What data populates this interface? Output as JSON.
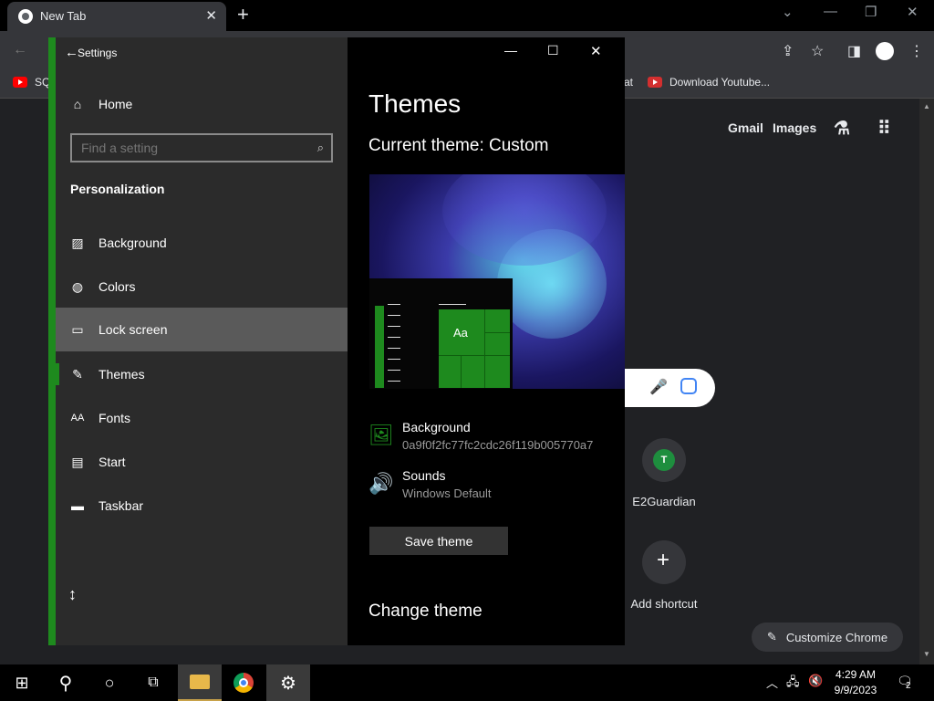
{
  "browser": {
    "tab_title": "New Tab",
    "bookmarks": [
      {
        "label": "SQ"
      },
      {
        "label": "at"
      },
      {
        "label": "Download Youtube..."
      }
    ],
    "links": {
      "gmail": "Gmail",
      "images": "Images"
    },
    "shortcuts": [
      {
        "label": "E2Guardian",
        "badge": "T"
      },
      {
        "label": "Add shortcut"
      }
    ],
    "customize_label": "Customize Chrome"
  },
  "settings": {
    "window_title": "Settings",
    "nav": {
      "home": "Home",
      "search_placeholder": "Find a setting",
      "section": "Personalization",
      "items": [
        {
          "label": "Background",
          "icon": "image-icon"
        },
        {
          "label": "Colors",
          "icon": "palette-icon"
        },
        {
          "label": "Lock screen",
          "icon": "lock-screen-icon"
        },
        {
          "label": "Themes",
          "icon": "themes-icon"
        },
        {
          "label": "Fonts",
          "icon": "fonts-icon"
        },
        {
          "label": "Start",
          "icon": "start-icon"
        },
        {
          "label": "Taskbar",
          "icon": "taskbar-icon"
        }
      ]
    },
    "main": {
      "title": "Themes",
      "current_theme": "Current theme: Custom",
      "preview_tile_label": "Aa",
      "background_label": "Background",
      "background_value": "0a9f0f2fc77fc2cdc26f119b005770a7",
      "sounds_label": "Sounds",
      "sounds_value": "Windows Default",
      "save_button": "Save theme",
      "change_theme": "Change theme"
    }
  },
  "taskbar": {
    "time": "4:29 AM",
    "date": "9/9/2023",
    "notifications": "2"
  },
  "colors": {
    "accent": "#1e8a1e",
    "chrome_bg": "#202124",
    "settings_nav_bg": "#2b2b2b",
    "settings_main_bg": "#000000"
  }
}
